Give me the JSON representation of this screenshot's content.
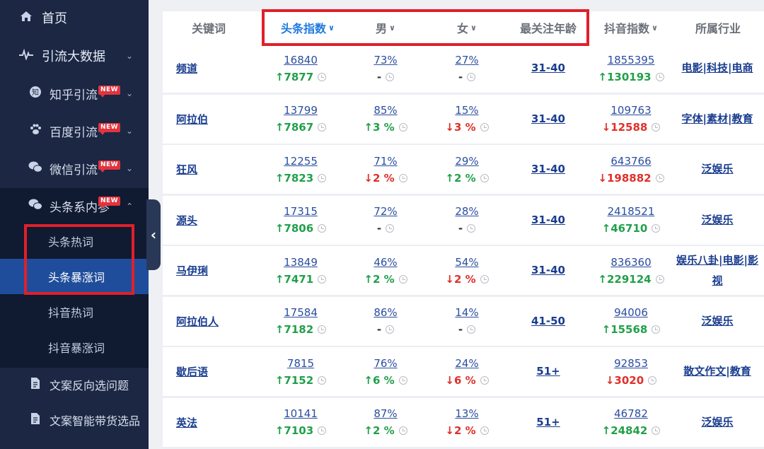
{
  "sidebar": {
    "home": {
      "label": "首页",
      "icon": "home-icon"
    },
    "traffic": {
      "label": "引流大数据",
      "icon": "pulse-icon"
    },
    "zhihu": {
      "label": "知乎引流",
      "icon": "zhihu-icon",
      "badge": "NEW"
    },
    "baidu": {
      "label": "百度引流",
      "icon": "paw-icon",
      "badge": "NEW"
    },
    "wechat": {
      "label": "微信引流",
      "icon": "wechat-icon",
      "badge": "NEW"
    },
    "toutiao": {
      "label": "头条系内参",
      "icon": "wechat-icon",
      "badge": "NEW"
    },
    "sub_items": [
      "头条热词",
      "头条暴涨词",
      "抖音热词",
      "抖音暴涨词"
    ],
    "copy_reverse": {
      "label": "文案反向选问题",
      "icon": "doc-icon"
    },
    "copy_smart": {
      "label": "文案智能带货选品",
      "icon": "doc-icon"
    }
  },
  "table": {
    "headers": {
      "keyword": "关键词",
      "toutiao_index": "头条指数",
      "male": "男",
      "female": "女",
      "age": "最关注年龄",
      "douyin_index": "抖音指数",
      "industry": "所属行业"
    },
    "rows": [
      {
        "kw": "频道",
        "tt": "16840",
        "tt_chg": "7877",
        "tt_dir": "up",
        "m": "73%",
        "m_chg": "-",
        "m_dir": "flat",
        "f": "27%",
        "f_chg": "-",
        "f_dir": "flat",
        "age": "31-40",
        "dy": "1855395",
        "dy_chg": "130193",
        "dy_dir": "up",
        "ind": "电影|科技|电商"
      },
      {
        "kw": "阿拉伯",
        "tt": "13799",
        "tt_chg": "7867",
        "tt_dir": "up",
        "m": "85%",
        "m_chg": "3 %",
        "m_dir": "up",
        "f": "15%",
        "f_chg": "3 %",
        "f_dir": "down",
        "age": "31-40",
        "dy": "109763",
        "dy_chg": "12588",
        "dy_dir": "down",
        "ind": "字体|素材|教育"
      },
      {
        "kw": "狂风",
        "tt": "12255",
        "tt_chg": "7823",
        "tt_dir": "up",
        "m": "71%",
        "m_chg": "2 %",
        "m_dir": "down",
        "f": "29%",
        "f_chg": "2 %",
        "f_dir": "up",
        "age": "31-40",
        "dy": "643766",
        "dy_chg": "198882",
        "dy_dir": "down",
        "ind": "泛娱乐"
      },
      {
        "kw": "源头",
        "tt": "17315",
        "tt_chg": "7806",
        "tt_dir": "up",
        "m": "72%",
        "m_chg": "-",
        "m_dir": "flat",
        "f": "28%",
        "f_chg": "-",
        "f_dir": "flat",
        "age": "31-40",
        "dy": "2418521",
        "dy_chg": "46710",
        "dy_dir": "up",
        "ind": "泛娱乐"
      },
      {
        "kw": "马伊琍",
        "tt": "13849",
        "tt_chg": "7471",
        "tt_dir": "up",
        "m": "46%",
        "m_chg": "2 %",
        "m_dir": "up",
        "f": "54%",
        "f_chg": "2 %",
        "f_dir": "down",
        "age": "31-40",
        "dy": "836360",
        "dy_chg": "229124",
        "dy_dir": "up",
        "ind": "娱乐八卦|电影|影视"
      },
      {
        "kw": "阿拉伯人",
        "tt": "17584",
        "tt_chg": "7182",
        "tt_dir": "up",
        "m": "86%",
        "m_chg": "-",
        "m_dir": "flat",
        "f": "14%",
        "f_chg": "-",
        "f_dir": "flat",
        "age": "41-50",
        "dy": "94006",
        "dy_chg": "15568",
        "dy_dir": "up",
        "ind": "泛娱乐"
      },
      {
        "kw": "歇后语",
        "tt": "7815",
        "tt_chg": "7152",
        "tt_dir": "up",
        "m": "76%",
        "m_chg": "6 %",
        "m_dir": "up",
        "f": "24%",
        "f_chg": "6 %",
        "f_dir": "down",
        "age": "51+",
        "dy": "92853",
        "dy_chg": "3020",
        "dy_dir": "down",
        "ind": "散文作文|教育"
      },
      {
        "kw": "英法",
        "tt": "10141",
        "tt_chg": "7103",
        "tt_dir": "up",
        "m": "87%",
        "m_chg": "2 %",
        "m_dir": "up",
        "f": "13%",
        "f_chg": "2 %",
        "f_dir": "down",
        "age": "51+",
        "dy": "46782",
        "dy_chg": "24842",
        "dy_dir": "up",
        "ind": "泛娱乐"
      }
    ]
  },
  "colors": {
    "sidebar": "#1b2743",
    "active": "#1f4d9c",
    "up": "#21a04a",
    "down": "#e0302a",
    "highlight": "#e0202a",
    "link": "#1a3d8f"
  }
}
